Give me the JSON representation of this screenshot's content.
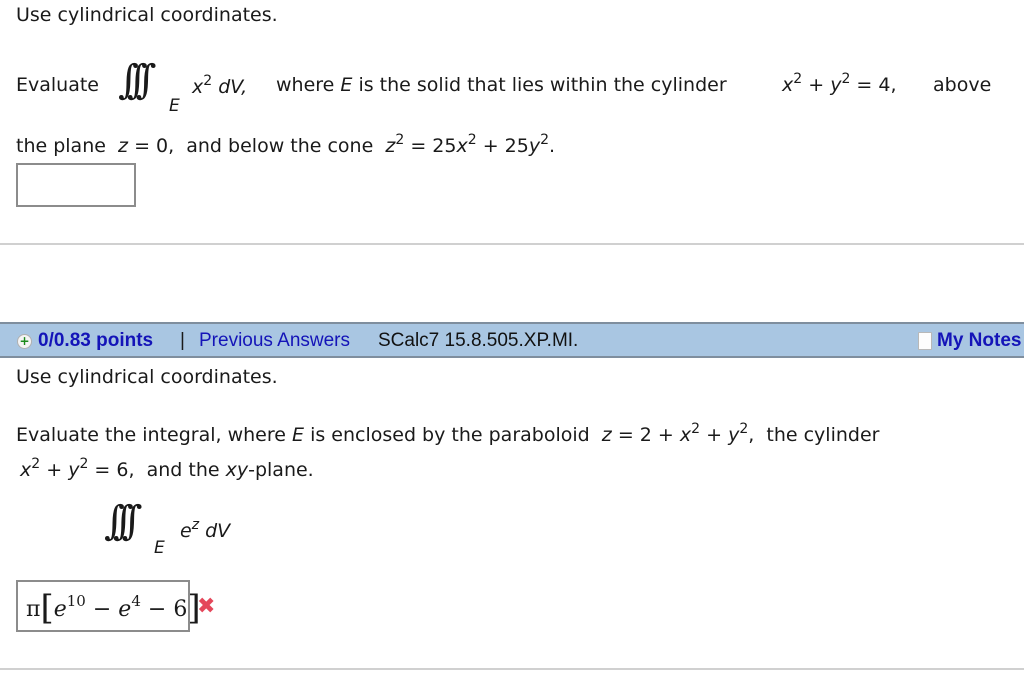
{
  "question1": {
    "instruction": "Use cylindrical coordinates.",
    "evaluate_label": "Evaluate",
    "integral_symbol": "∫∫∫",
    "region": "E",
    "integrand_base": "x",
    "integrand_exp": "2",
    "differential": "dV,",
    "desc_part1": "where",
    "desc_region": "E",
    "desc_part2": "is the solid that lies within the cylinder",
    "cyl_x": "x",
    "cyl_exp1": "2",
    "cyl_plus": "+",
    "cyl_y": "y",
    "cyl_exp2": "2",
    "cyl_eq": "= 4,",
    "above": "above",
    "line2_part1": "the plane",
    "plane_eq_var": "z",
    "plane_eq_rest": "= 0,",
    "line2_part2": "and below the cone",
    "cone_z": "z",
    "cone_exp1": "2",
    "cone_rest1": "= 25",
    "cone_x": "x",
    "cone_exp2": "2",
    "cone_rest2": "+ 25",
    "cone_y": "y",
    "cone_exp3": "2",
    "cone_end": ".",
    "answer_value": ""
  },
  "question2": {
    "header": {
      "points": "0/0.83 points",
      "separator": "|",
      "previous_answers": "Previous Answers",
      "problem_code": "SCalc7 15.8.505.XP.MI.",
      "my_notes": "My Notes"
    },
    "instruction": "Use cylindrical coordinates.",
    "line1_part1": "Evaluate the integral, where",
    "line1_region": "E",
    "line1_part2": "is enclosed by the paraboloid",
    "par_z": "z",
    "par_eq": "= 2 +",
    "par_x": "x",
    "par_exp1": "2",
    "par_plus": "+",
    "par_y": "y",
    "par_exp2": "2",
    "par_comma": ",",
    "line1_part3": "the cylinder",
    "line2_x": "x",
    "line2_exp1": "2",
    "line2_plus": "+",
    "line2_y": "y",
    "line2_exp2": "2",
    "line2_eq": "= 6,",
    "line2_part2": "and the",
    "line2_xy": "xy",
    "line2_part3": "-plane.",
    "integral_symbol": "∫∫∫",
    "region": "E",
    "integrand_base": "e",
    "integrand_exp": "z",
    "differential": "dV",
    "answer": {
      "pi": "π",
      "lbracket": "[",
      "e1": "e",
      "e1_exp": "10",
      "minus1": "−",
      "e2": "e",
      "e2_exp": "4",
      "minus2": "−",
      "const": "6",
      "rbracket": "]"
    },
    "status": "incorrect",
    "status_icon": "✖"
  },
  "colors": {
    "header_bg": "#a9c6e2",
    "link_blue": "#1414b8",
    "incorrect_red": "#e4475a"
  }
}
